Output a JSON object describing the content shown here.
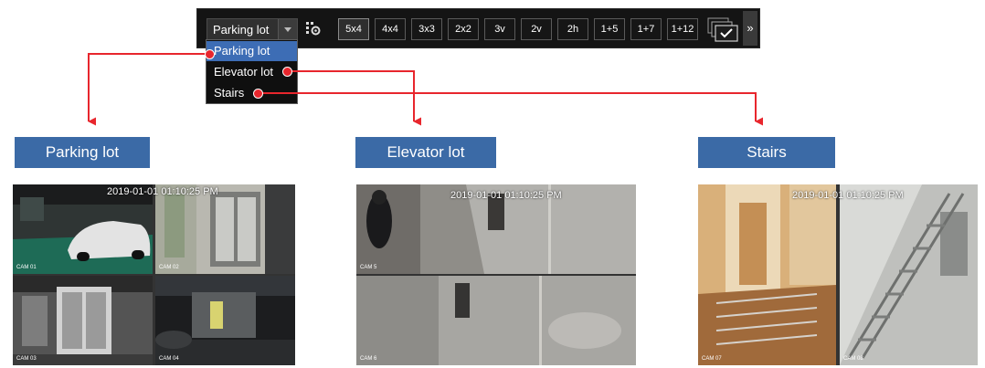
{
  "toolbar": {
    "group_selected": "Parking lot",
    "layouts": [
      "5x4",
      "4x4",
      "3x3",
      "2x2",
      "3v",
      "2v",
      "2h",
      "1+5",
      "1+7",
      "1+12"
    ],
    "active_layout": "5x4",
    "more_label": "»"
  },
  "dropdown": {
    "items": [
      "Parking lot",
      "Elevator lot",
      "Stairs"
    ],
    "selected_index": 0
  },
  "sections": [
    {
      "title": "Parking lot",
      "timestamp": "2019-01-01 01:10:25 PM",
      "cams": [
        "CAM 01",
        "CAM 02",
        "CAM 03",
        "CAM 04"
      ]
    },
    {
      "title": "Elevator lot",
      "timestamp": "2019-01-01 01:10:25 PM",
      "cams": [
        "CAM 5",
        "CAM 6"
      ]
    },
    {
      "title": "Stairs",
      "timestamp": "2019-01-01 01:10:25 PM",
      "cams": [
        "CAM 07",
        "CAM 08"
      ]
    }
  ],
  "colors": {
    "arrow": "#e8262d",
    "title_bg": "#3b6aa6",
    "selected_item": "#3d6db5",
    "toolbar_bg": "#141414"
  }
}
